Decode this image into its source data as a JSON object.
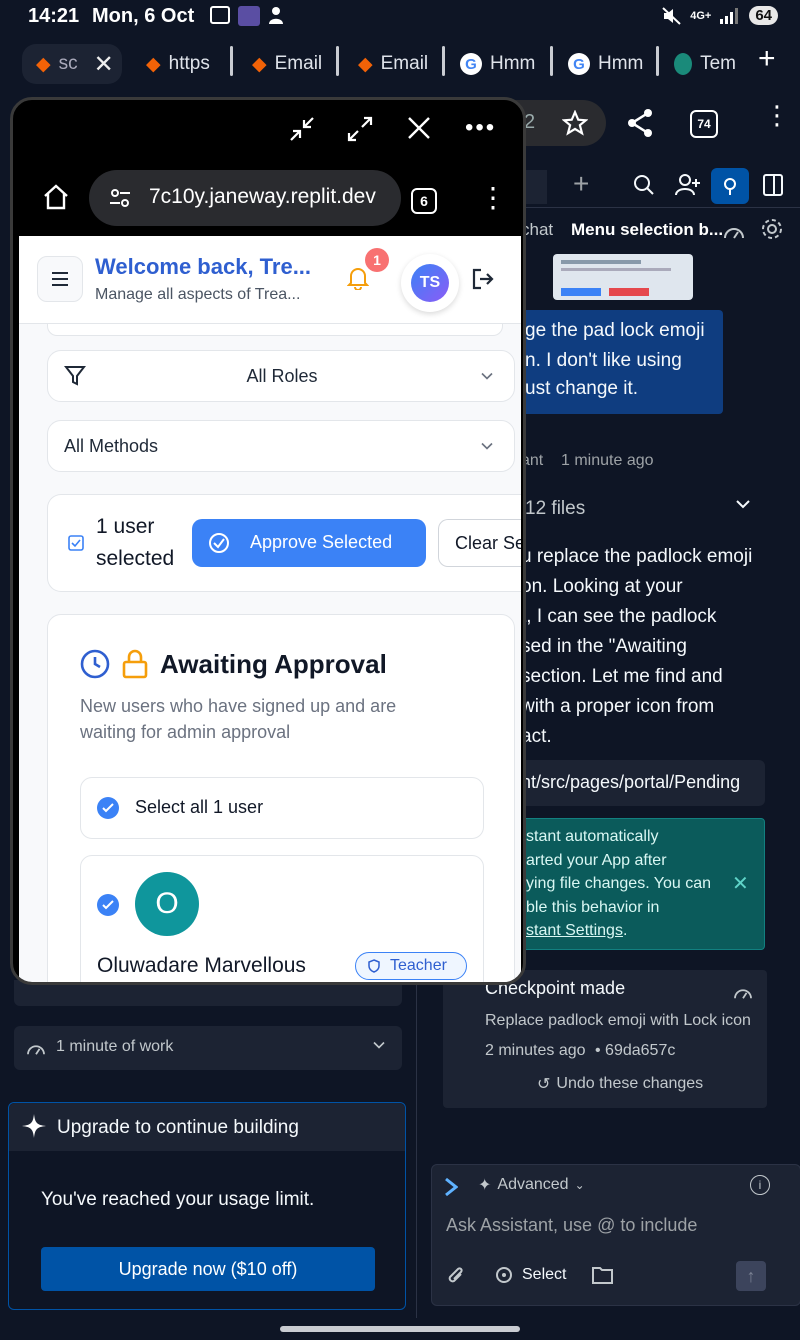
{
  "status": {
    "time": "14:21",
    "date": "Mon, 6 Oct",
    "battery": "64",
    "network": "4G+"
  },
  "tabs": [
    {
      "label": "sc"
    },
    {
      "label": "https"
    },
    {
      "label": "Email"
    },
    {
      "label": "Email"
    },
    {
      "label": "Hmm"
    },
    {
      "label": "Hmm"
    },
    {
      "label": "Tem"
    }
  ],
  "bg_toolbar": {
    "url_tail": "2",
    "tab_count": "74"
  },
  "right_panel": {
    "chat_tab": "chat",
    "active_tab": "Menu selection b...",
    "user_msg_lines": [
      "ge the pad lock emoji",
      "n. I don't like using",
      "ust change it."
    ],
    "assistant_label": "ant",
    "assistant_time": "1 minute ago",
    "files_label": "12 files",
    "reply_lines": [
      "u replace the padlock emoji",
      "on. Looking at your",
      "t, I can see the padlock",
      "sed in the \"Awaiting",
      " section. Let me find and",
      "with a proper icon from",
      "act."
    ],
    "file_path": "nt/src/pages/portal/Pending",
    "notice_lines": [
      "stant automatically",
      "arted your App after",
      "ying file changes. You can",
      "ble this behavior in"
    ],
    "notice_link": "stant Settings",
    "notice_link_suffix": ".",
    "checkpoint_title": "Checkpoint made",
    "checkpoint_desc": "Replace padlock emoji with Lock icon",
    "checkpoint_time": "2 minutes ago",
    "checkpoint_hash": "• 69da657c",
    "undo_label": "Undo these changes",
    "composer_mode": "Advanced",
    "composer_placeholder": "Ask Assistant, use @ to include",
    "select_label": "Select"
  },
  "left_panel": {
    "work_label": "1 minute of work",
    "upgrade_title": "Upgrade to continue building",
    "limit_text": "You've reached your usage limit.",
    "upgrade_button": "Upgrade now ($10 off)"
  },
  "float_browser": {
    "url": "7c10y.janeway.replit.dev",
    "tab_count": "6"
  },
  "app": {
    "welcome_title": "Welcome back, Tre...",
    "welcome_sub": "Manage all aspects of Trea...",
    "notif_count": "1",
    "avatar_initials": "TS",
    "roles_filter": "All Roles",
    "methods_filter": "All Methods",
    "selected_count_line1": "1 user",
    "selected_count_line2": "selected",
    "approve_button": "Approve Selected",
    "clear_button": "Clear Sel",
    "section_title": "Awaiting Approval",
    "section_desc_line1": "New users who have signed up and are",
    "section_desc_line2": "waiting for admin approval",
    "select_all": "Select all 1 user",
    "user_initial": "O",
    "user_name": "Oluwadare Marvellous",
    "role_badge": "Teacher"
  },
  "colors": {
    "accent": "#3b82f6",
    "dark_bg": "#0e1525",
    "user_bubble": "#0f3d80",
    "notice_bg": "#0b5b5b",
    "avatar_teal": "#0f969c",
    "bell_orange": "#f59e0b",
    "lock_orange": "#f59e0b"
  }
}
